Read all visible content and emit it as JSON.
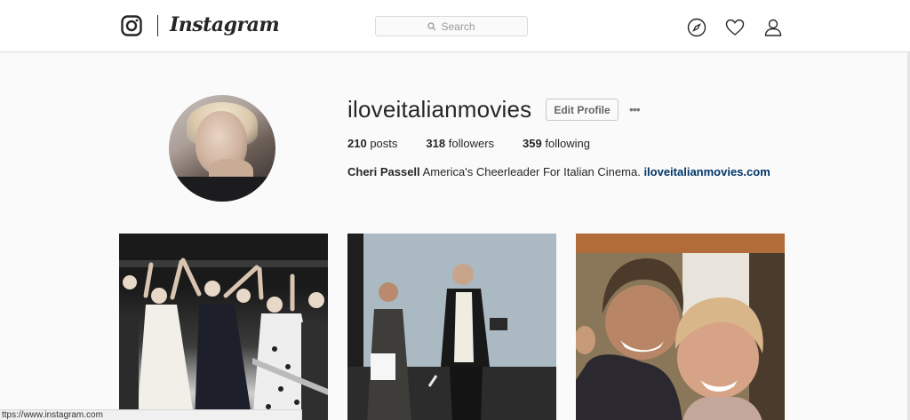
{
  "header": {
    "brand": "Instagram",
    "search_placeholder": "Search",
    "icons": [
      "compass-icon",
      "heart-icon",
      "profile-icon",
      "instagram-camera-icon"
    ]
  },
  "profile": {
    "username": "iloveitalianmovies",
    "edit_button": "Edit Profile",
    "more": "•••",
    "stats": [
      {
        "count": "210",
        "label": "posts"
      },
      {
        "count": "318",
        "label": "followers"
      },
      {
        "count": "359",
        "label": "following"
      }
    ],
    "bio": {
      "name": "Cheri Passell",
      "text": "America's Cheerleader For Italian Cinema.",
      "link": "iloveitalianmovies.com"
    }
  },
  "status_bar": {
    "url": "ttps://www.instagram.com"
  }
}
